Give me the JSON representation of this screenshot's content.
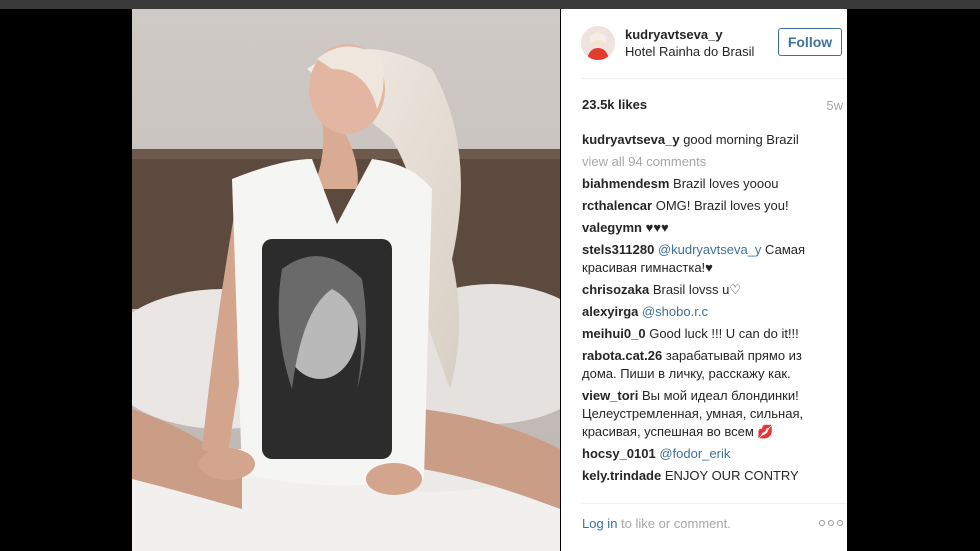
{
  "post": {
    "username": "kudryavtseva_y",
    "location": "Hotel Rainha do Brasil",
    "follow_label": "Follow",
    "likes": "23.5k likes",
    "age": "5w",
    "view_all": "view all 94 comments",
    "login_link": "Log in",
    "login_rest": " to like or comment."
  },
  "comments": [
    {
      "user": "kudryavtseva_y",
      "text": " good morning Brazil"
    },
    {
      "user": "biahmendesm",
      "text": " Brazil loves yooou"
    },
    {
      "user": "rcthalencar",
      "text": " OMG! Brazil loves you!"
    },
    {
      "user": "valegymn",
      "text": " ♥♥♥"
    },
    {
      "user": "stels311280",
      "mention": " @kudryavtseva_y",
      "text": " Самая красивая гимнастка!♥"
    },
    {
      "user": "chrisozaka",
      "text": " Brasil lovss u♡"
    },
    {
      "user": "alexyirga",
      "mention": " @shobo.r.c",
      "text": ""
    },
    {
      "user": "meihui0_0",
      "text": " Good luck !!! U can do it!!!"
    },
    {
      "user": "rabota.cat.26",
      "text": " зарабатывай прямо из дома. Пиши в личку, расскажу как."
    },
    {
      "user": "view_tori",
      "text": " Вы мой идеал блондинки! Целеустремленная, умная, сильная, красивая, успешная во всем 💋"
    },
    {
      "user": "hocsy_0101",
      "mention": " @fodor_erik",
      "text": ""
    },
    {
      "user": "kely.trindade",
      "text": " ENJOY OUR CONTRY"
    }
  ]
}
